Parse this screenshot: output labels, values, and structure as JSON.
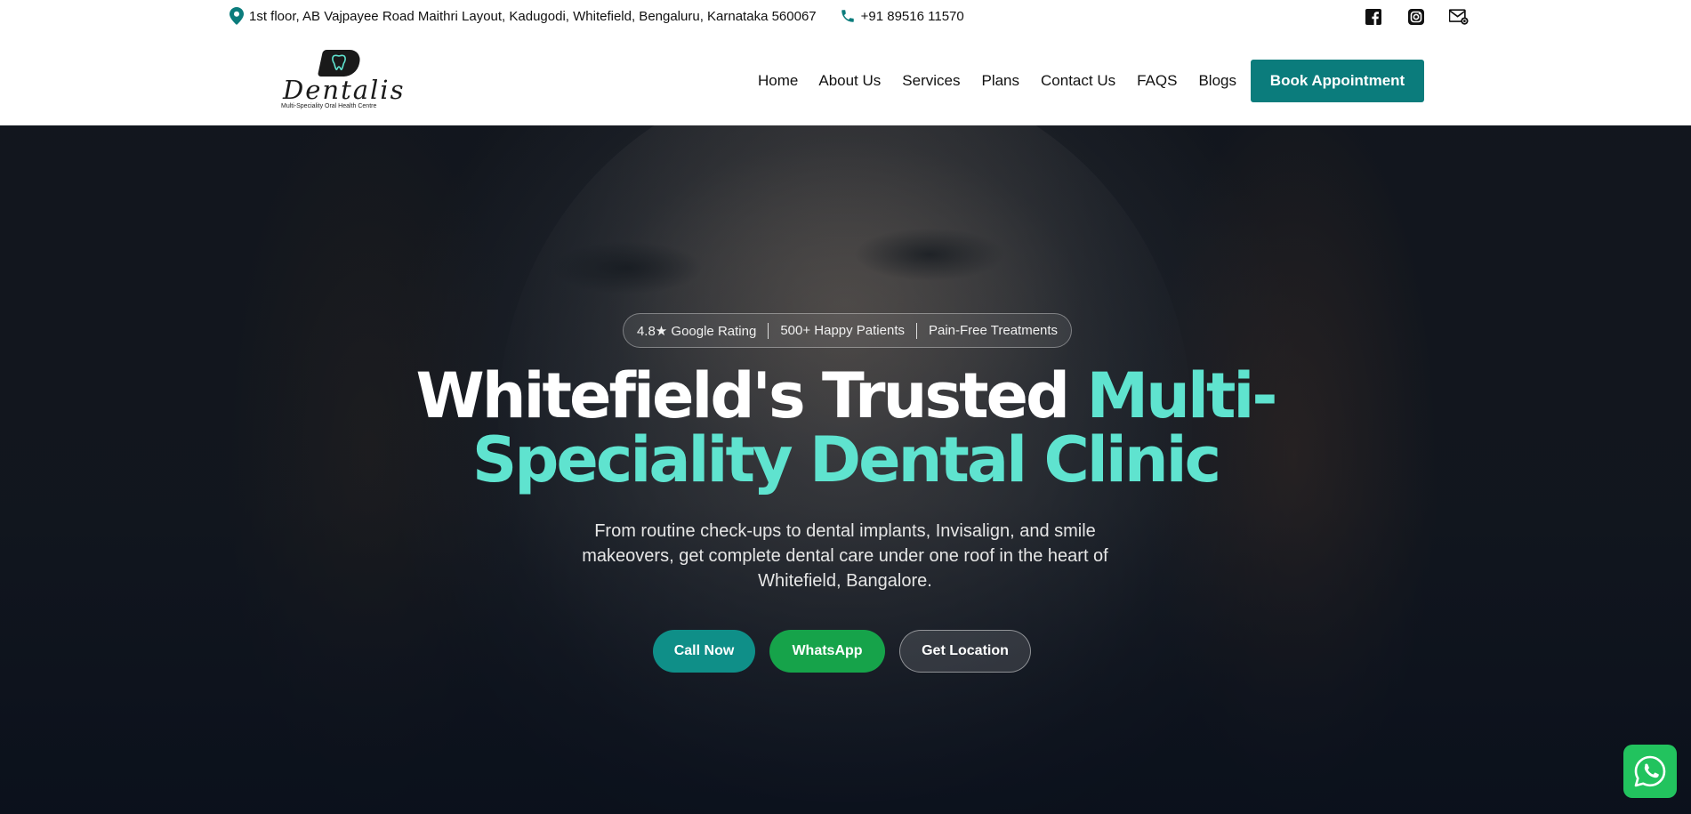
{
  "topbar": {
    "address": "1st floor, AB Vajpayee Road Maithri Layout, Kadugodi, Whitefield, Bengaluru, Karnataka 560067",
    "phone": "+91 89516 11570",
    "icons": [
      "location-pin-icon",
      "phone-icon",
      "facebook-icon",
      "instagram-icon",
      "mail-icon"
    ],
    "accent_color": "#0b7c7c"
  },
  "header": {
    "logo": {
      "name": "Dentalis",
      "tagline": "Multi-Speciality Oral Health Centre"
    },
    "nav": [
      "Home",
      "About Us",
      "Services",
      "Plans",
      "Contact Us",
      "FAQS",
      "Blogs"
    ],
    "book_button": "Book Appointment",
    "book_button_color": "#0b7c7c"
  },
  "hero": {
    "badges": [
      "4.8★ Google Rating",
      "500+ Happy Patients",
      "Pain-Free Treatments"
    ],
    "headline_white": "Whitefield's Trusted",
    "headline_accent_1": "Multi-",
    "headline_accent_2": "Speciality Dental Clinic",
    "accent_color": "#5fe3cf",
    "subtitle": "From routine check-ups to dental implants, Invisalign, and smile makeovers, get complete dental care under one roof in the heart of Whitefield, Bangalore.",
    "buttons": {
      "call": "Call Now",
      "whatsapp": "WhatsApp",
      "location": "Get Location"
    },
    "button_colors": {
      "call": "#0f8f88",
      "whatsapp": "#16a34a"
    }
  },
  "floating": {
    "icon": "whatsapp-icon",
    "color": "#22c35e"
  }
}
